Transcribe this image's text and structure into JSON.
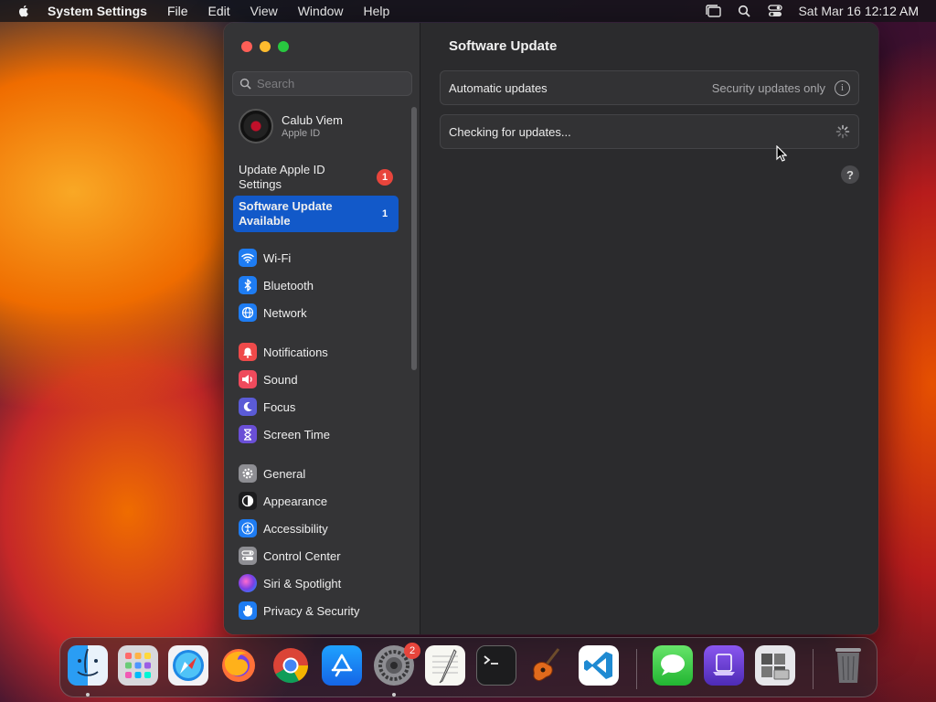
{
  "menubar": {
    "app_name": "System Settings",
    "items": [
      "File",
      "Edit",
      "View",
      "Window",
      "Help"
    ],
    "clock": "Sat Mar 16  12:12 AM"
  },
  "sidebar": {
    "search_placeholder": "Search",
    "account": {
      "name": "Calub Viem",
      "subtitle": "Apple ID"
    },
    "notices": [
      {
        "label": "Update Apple ID Settings",
        "badge": "1"
      },
      {
        "label": "Software Update Available",
        "badge": "1"
      }
    ],
    "items": [
      {
        "label": "Wi-Fi",
        "icon": "wifi-icon",
        "color": "#1e7cf2"
      },
      {
        "label": "Bluetooth",
        "icon": "bluetooth-icon",
        "color": "#1e7cf2"
      },
      {
        "label": "Network",
        "icon": "globe-icon",
        "color": "#1e7cf2"
      },
      {
        "label": "Notifications",
        "icon": "bell-icon",
        "color": "#ef4a4a"
      },
      {
        "label": "Sound",
        "icon": "speaker-icon",
        "color": "#ef4a5c"
      },
      {
        "label": "Focus",
        "icon": "moon-icon",
        "color": "#5b5bd6"
      },
      {
        "label": "Screen Time",
        "icon": "hourglass-icon",
        "color": "#6a4fd6"
      },
      {
        "label": "General",
        "icon": "gear-icon",
        "color": "#8e8e93"
      },
      {
        "label": "Appearance",
        "icon": "appearance-icon",
        "color": "#1c1c1e"
      },
      {
        "label": "Accessibility",
        "icon": "accessibility-icon",
        "color": "#1e7cf2"
      },
      {
        "label": "Control Center",
        "icon": "control-center-icon",
        "color": "#8e8e93"
      },
      {
        "label": "Siri & Spotlight",
        "icon": "siri-icon",
        "color": "#9b4fd6"
      },
      {
        "label": "Privacy & Security",
        "icon": "hand-icon",
        "color": "#1e7cf2"
      }
    ]
  },
  "main": {
    "title": "Software Update",
    "automatic_updates_label": "Automatic updates",
    "automatic_updates_value": "Security updates only",
    "status": "Checking for updates...",
    "help": "?"
  },
  "dock": {
    "apps": [
      "Finder",
      "Launchpad",
      "Safari",
      "Firefox",
      "Chrome",
      "App Store",
      "System Settings",
      "TextEdit",
      "Terminal",
      "GarageBand",
      "Visual Studio Code",
      "Messages",
      "Simulator",
      "Boot Camp",
      "Trash"
    ],
    "settings_badge": "2"
  }
}
